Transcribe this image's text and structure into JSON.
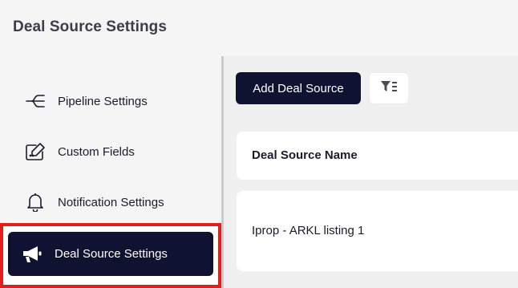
{
  "header": {
    "title": "Deal Source Settings"
  },
  "sidebar": {
    "items": [
      {
        "label": "Pipeline Settings",
        "icon": "pipeline-icon"
      },
      {
        "label": "Custom Fields",
        "icon": "edit-box-icon"
      },
      {
        "label": "Notification Settings",
        "icon": "bell-icon"
      },
      {
        "label": "Deal Source Settings",
        "icon": "megaphone-icon",
        "active": true
      }
    ]
  },
  "toolbar": {
    "add_label": "Add Deal Source",
    "filter_icon": "filter-icon"
  },
  "table": {
    "columns": [
      "Deal Source Name"
    ],
    "rows": [
      [
        "Iprop - ARKL listing 1"
      ]
    ]
  },
  "colors": {
    "primary": "#0f1230",
    "highlight_border": "#e01f1f",
    "background": "#f5f5f5"
  }
}
